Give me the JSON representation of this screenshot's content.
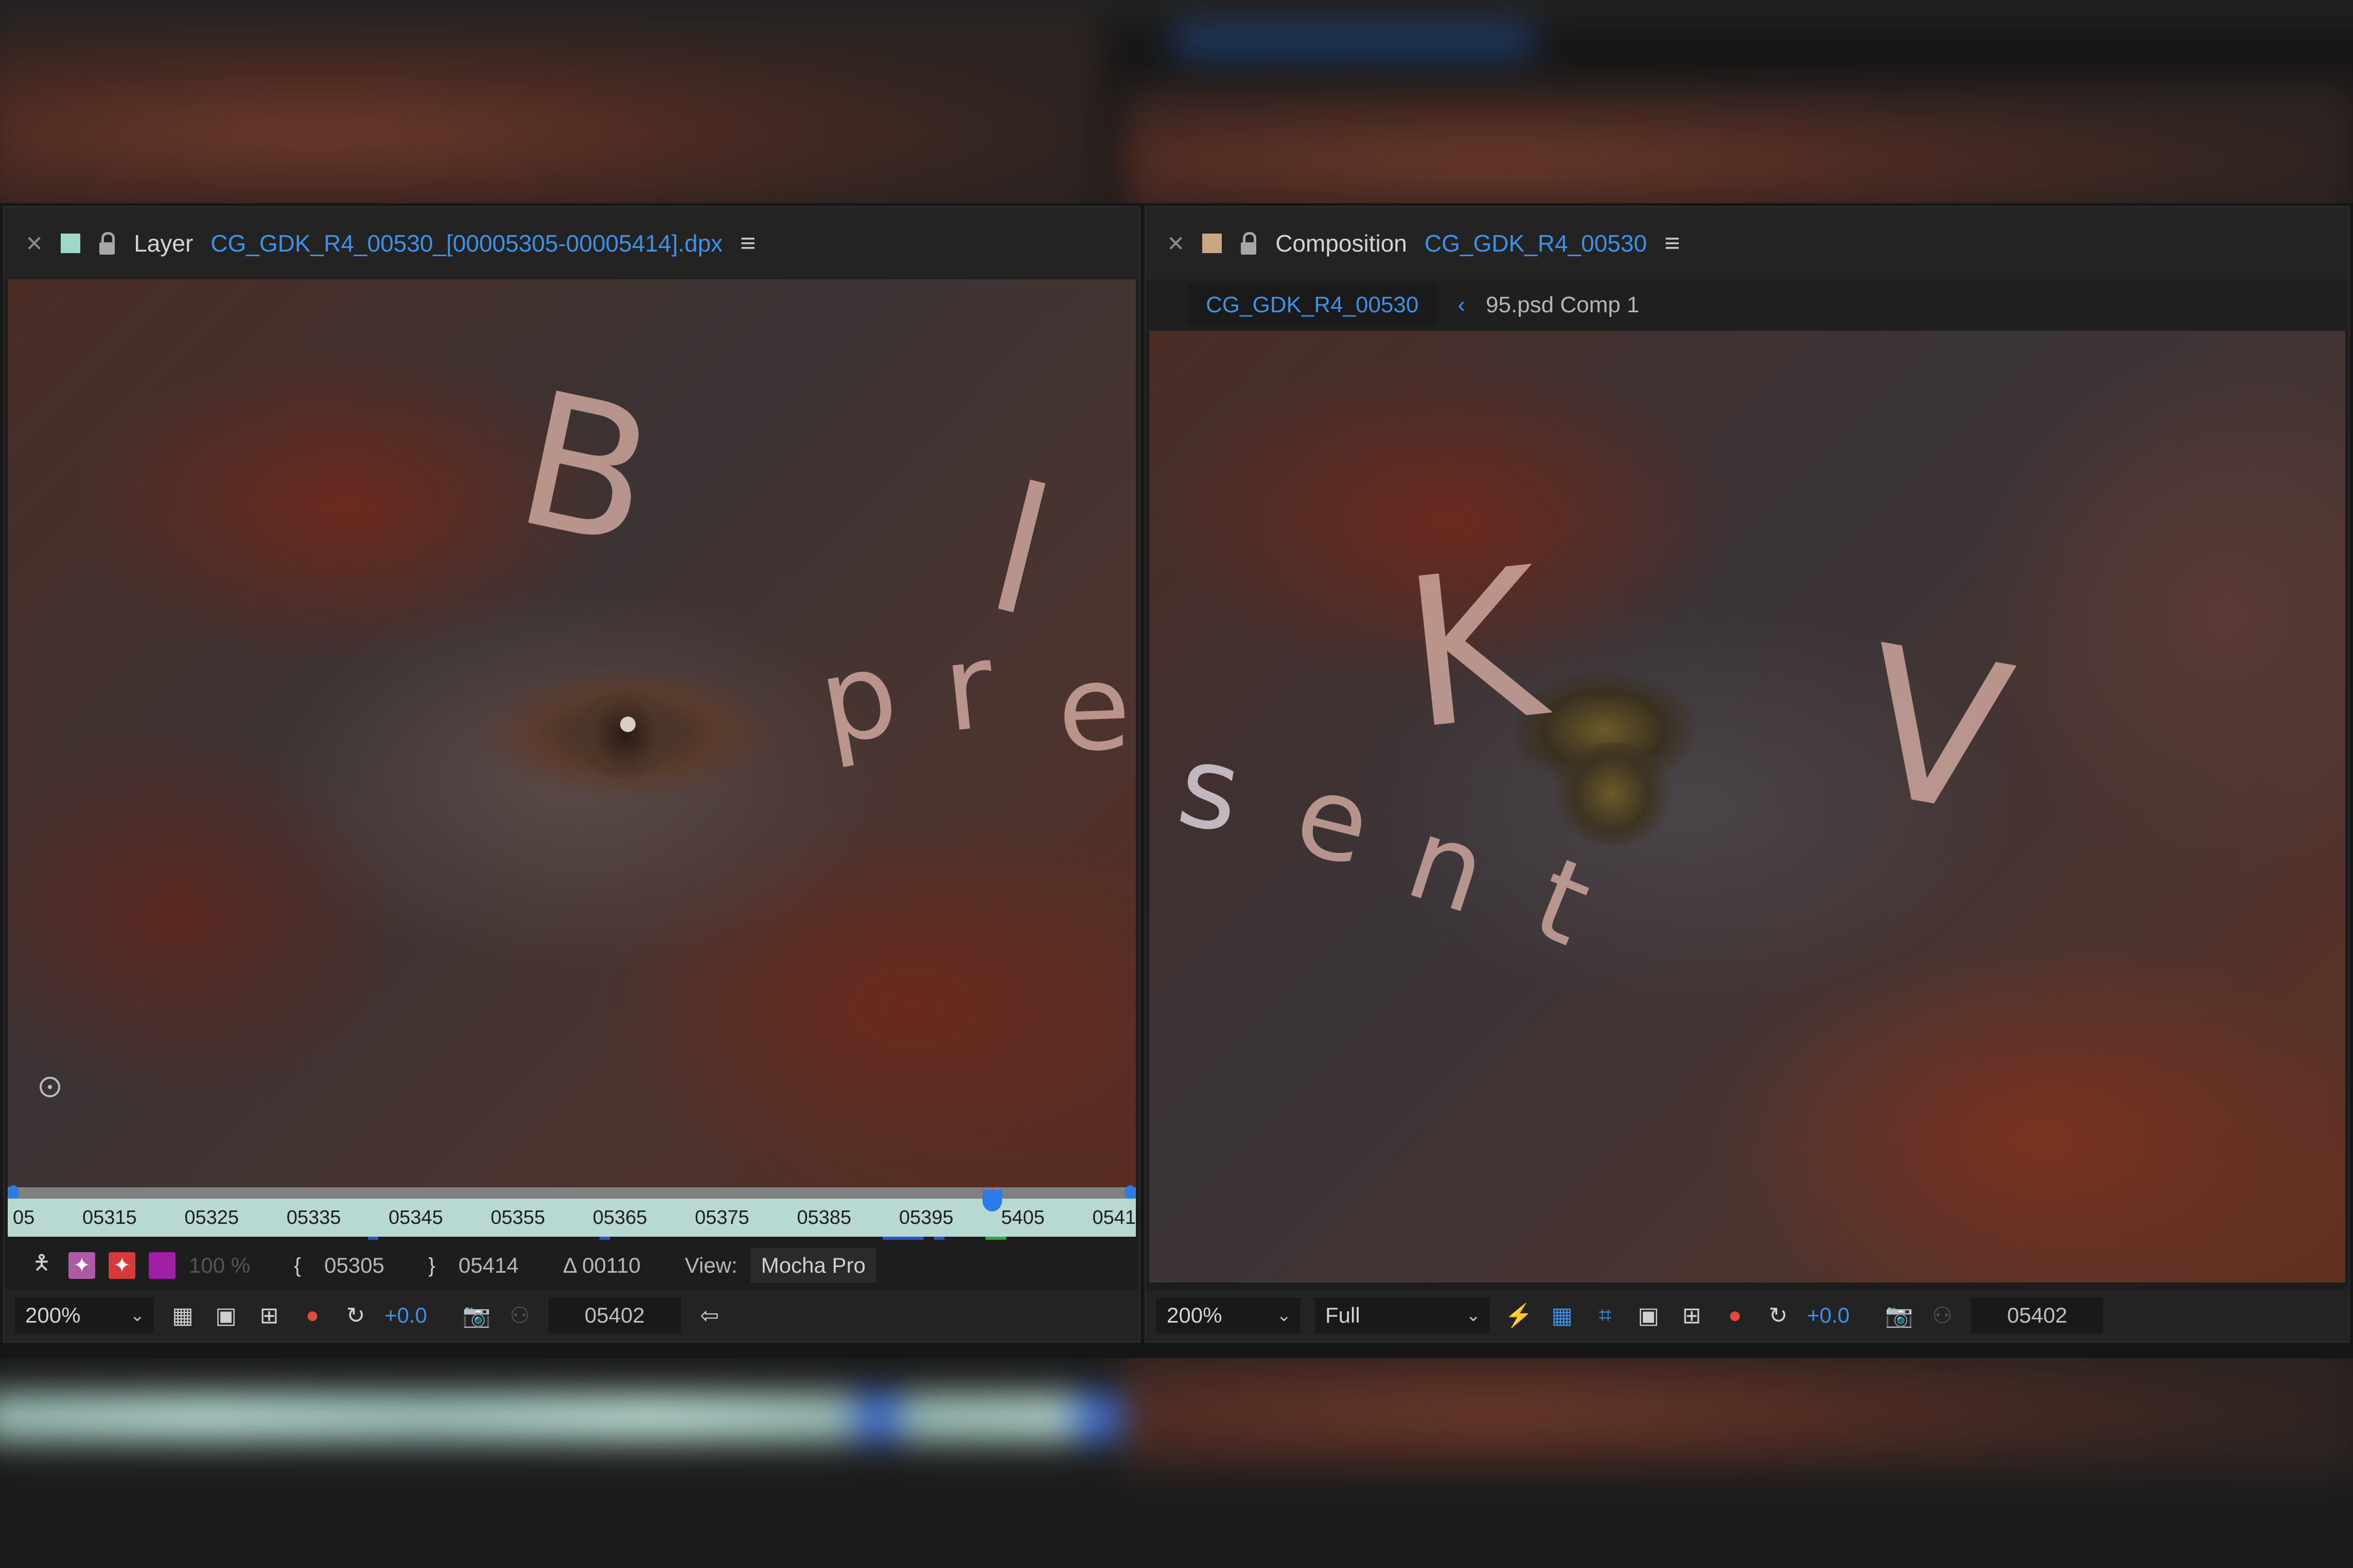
{
  "left_panel": {
    "tab": {
      "close_icon": "close-icon",
      "label_color": "#9fd7c8",
      "lock_icon": "lock-icon",
      "kind": "Layer",
      "name": "CG_GDK_R4_00530_[00005305-00005414].dpx",
      "menu_icon": "hamburger-menu-icon"
    },
    "overlay_glyphs": [
      "B",
      "l",
      "p",
      "r",
      "e"
    ],
    "timeline": {
      "ruler_labels": [
        "05",
        "05315",
        "05325",
        "05335",
        "05345",
        "05355",
        "05365",
        "05375",
        "05385",
        "05395",
        "5405",
        "0541"
      ],
      "playhead_frame": "05402"
    },
    "controls": {
      "in_point": "05305",
      "out_point": "05414",
      "duration": "Δ 00110",
      "opacity_disabled": "100 %",
      "view_label": "View:",
      "view_value": "Mocha Pro"
    },
    "bottom_bar": {
      "magnification": "200%",
      "exposure": "+0.0",
      "current_frame": "05402"
    }
  },
  "right_panel": {
    "tab": {
      "close_icon": "close-icon",
      "label_color": "#c8a882",
      "lock_icon": "lock-icon",
      "kind": "Composition",
      "name": "CG_GDK_R4_00530",
      "menu_icon": "hamburger-menu-icon"
    },
    "breadcrumbs": {
      "active": "CG_GDK_R4_00530",
      "separator": "‹",
      "next": "95.psd Comp 1"
    },
    "overlay_glyphs": [
      "K",
      "V",
      "s",
      "e",
      "n",
      "t"
    ],
    "bottom_bar": {
      "magnification": "200%",
      "resolution": "Full",
      "exposure": "+0.0",
      "current_frame": "05402"
    }
  },
  "colors": {
    "accent_blue": "#3e91e8",
    "timeline_fill": "#b8d9d1",
    "panel_bg": "#1d1d1d"
  }
}
